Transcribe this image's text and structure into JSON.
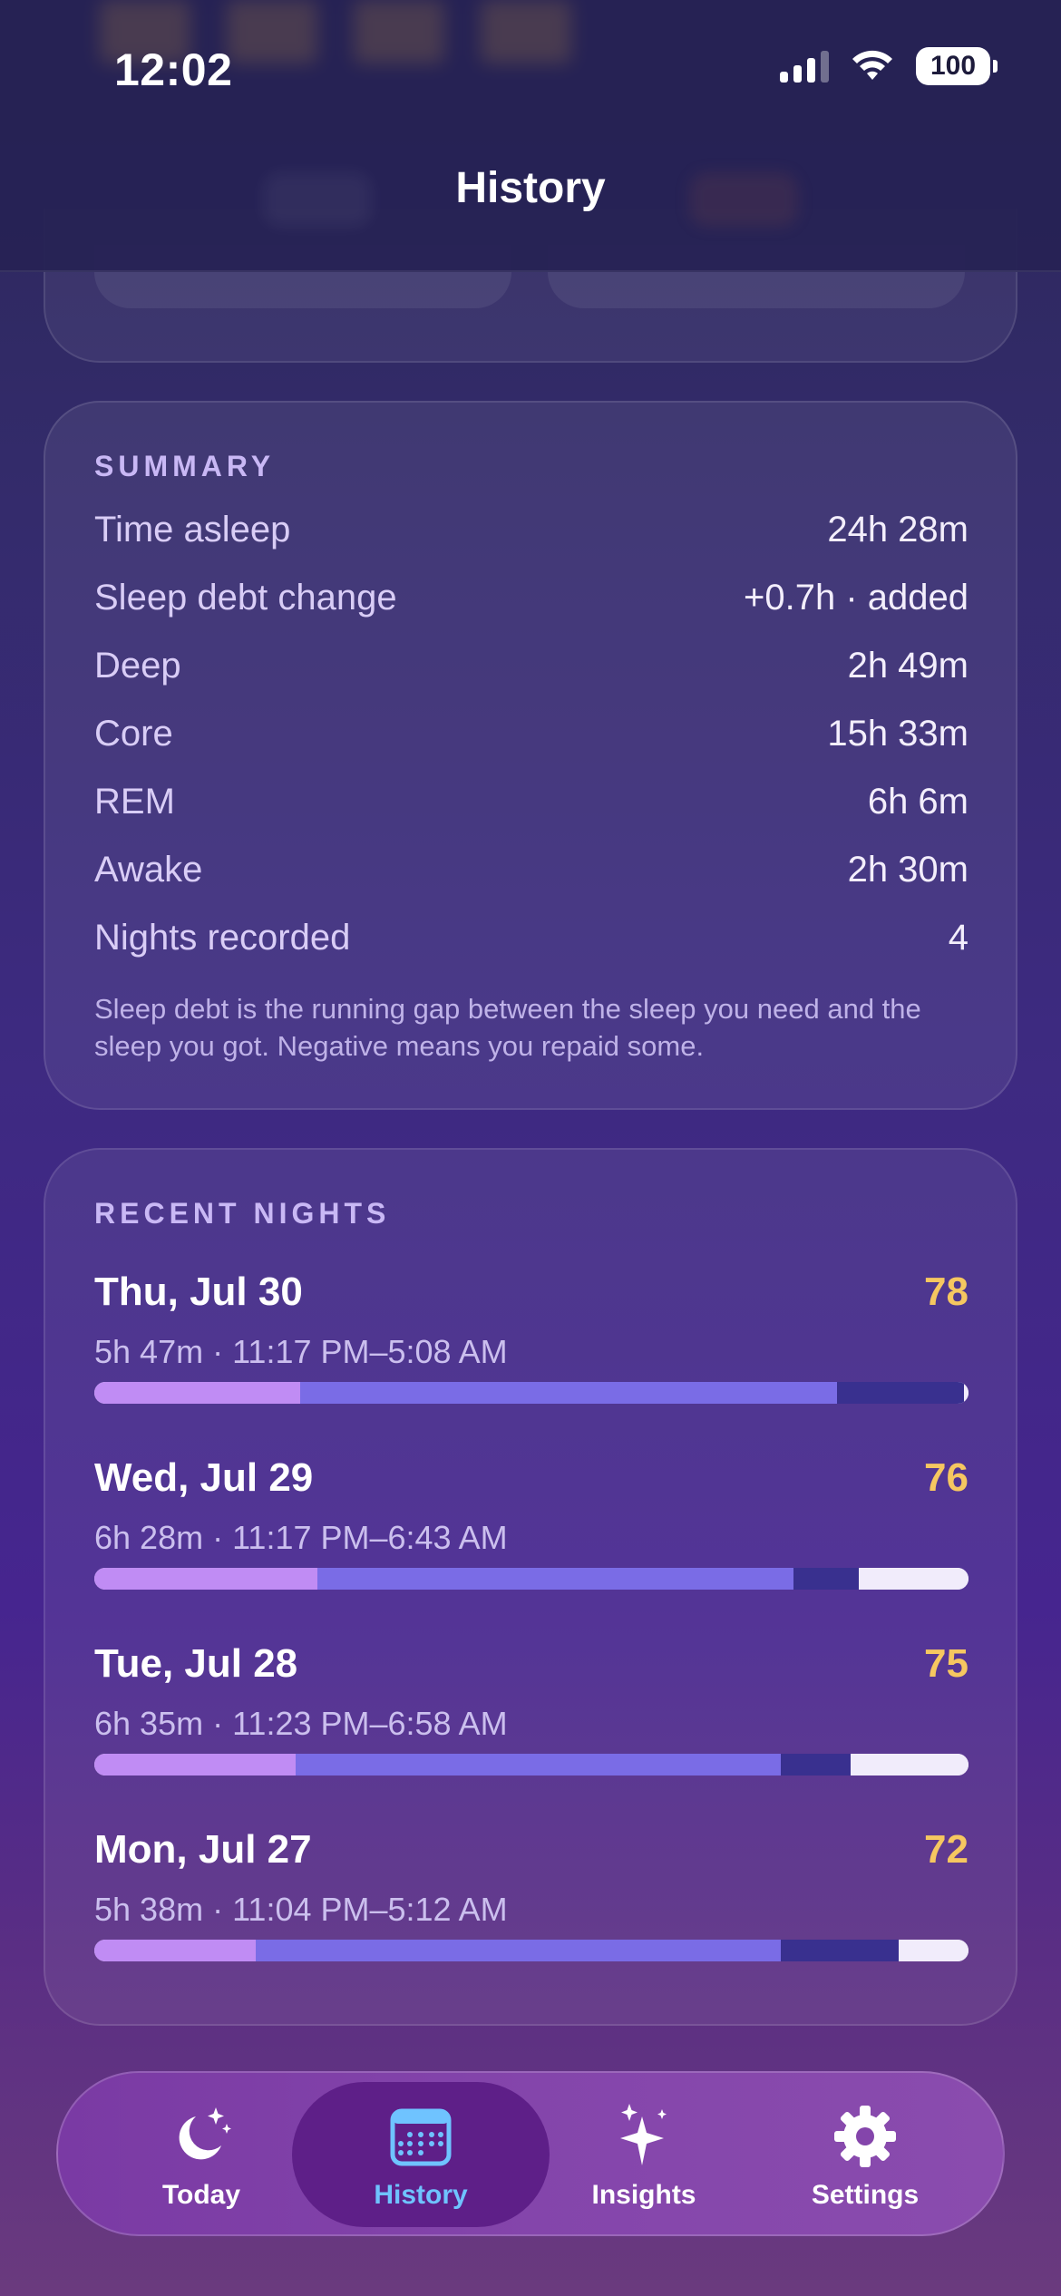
{
  "status_bar": {
    "time": "12:02",
    "battery": "100"
  },
  "header": {
    "title": "History"
  },
  "summary": {
    "label": "SUMMARY",
    "rows": [
      {
        "key": "Time asleep",
        "value": "24h 28m"
      },
      {
        "key": "Sleep debt change",
        "value": "+0.7h · added"
      },
      {
        "key": "Deep",
        "value": "2h 49m"
      },
      {
        "key": "Core",
        "value": "15h 33m"
      },
      {
        "key": "REM",
        "value": "6h 6m"
      },
      {
        "key": "Awake",
        "value": "2h 30m"
      },
      {
        "key": "Nights recorded",
        "value": "4"
      }
    ],
    "note": "Sleep debt is the running gap between the sleep you need and the sleep you got. Negative means you repaid some."
  },
  "recent": {
    "label": "RECENT NIGHTS",
    "nights": [
      {
        "date": "Thu, Jul 30",
        "score": "78",
        "detail": "5h 47m · 11:17 PM–5:08 AM",
        "stages": {
          "deep": 23.5,
          "core": 61.5,
          "rem": 14.5,
          "awake": 0.5
        }
      },
      {
        "date": "Wed, Jul 29",
        "score": "76",
        "detail": "6h 28m · 11:17 PM–6:43 AM",
        "stages": {
          "deep": 25.5,
          "core": 54.5,
          "rem": 7.5,
          "awake": 12.5
        }
      },
      {
        "date": "Tue, Jul 28",
        "score": "75",
        "detail": "6h 35m · 11:23 PM–6:58 AM",
        "stages": {
          "deep": 23.0,
          "core": 55.5,
          "rem": 8.0,
          "awake": 13.5
        }
      },
      {
        "date": "Mon, Jul 27",
        "score": "72",
        "detail": "5h 38m · 11:04 PM–5:12 AM",
        "stages": {
          "deep": 18.5,
          "core": 60.0,
          "rem": 13.5,
          "awake": 8.0
        }
      }
    ]
  },
  "colors": {
    "deep": "#c08cf4",
    "core": "#7a6ce6",
    "rem": "#39308f",
    "awake": "#f1ecfb",
    "score": "#f6c760",
    "active_tab": "#6fc3ff"
  },
  "tabs": [
    {
      "label": "Today",
      "icon": "moon-stars-icon",
      "active": false
    },
    {
      "label": "History",
      "icon": "calendar-icon",
      "active": true
    },
    {
      "label": "Insights",
      "icon": "sparkles-icon",
      "active": false
    },
    {
      "label": "Settings",
      "icon": "gear-icon",
      "active": false
    }
  ]
}
